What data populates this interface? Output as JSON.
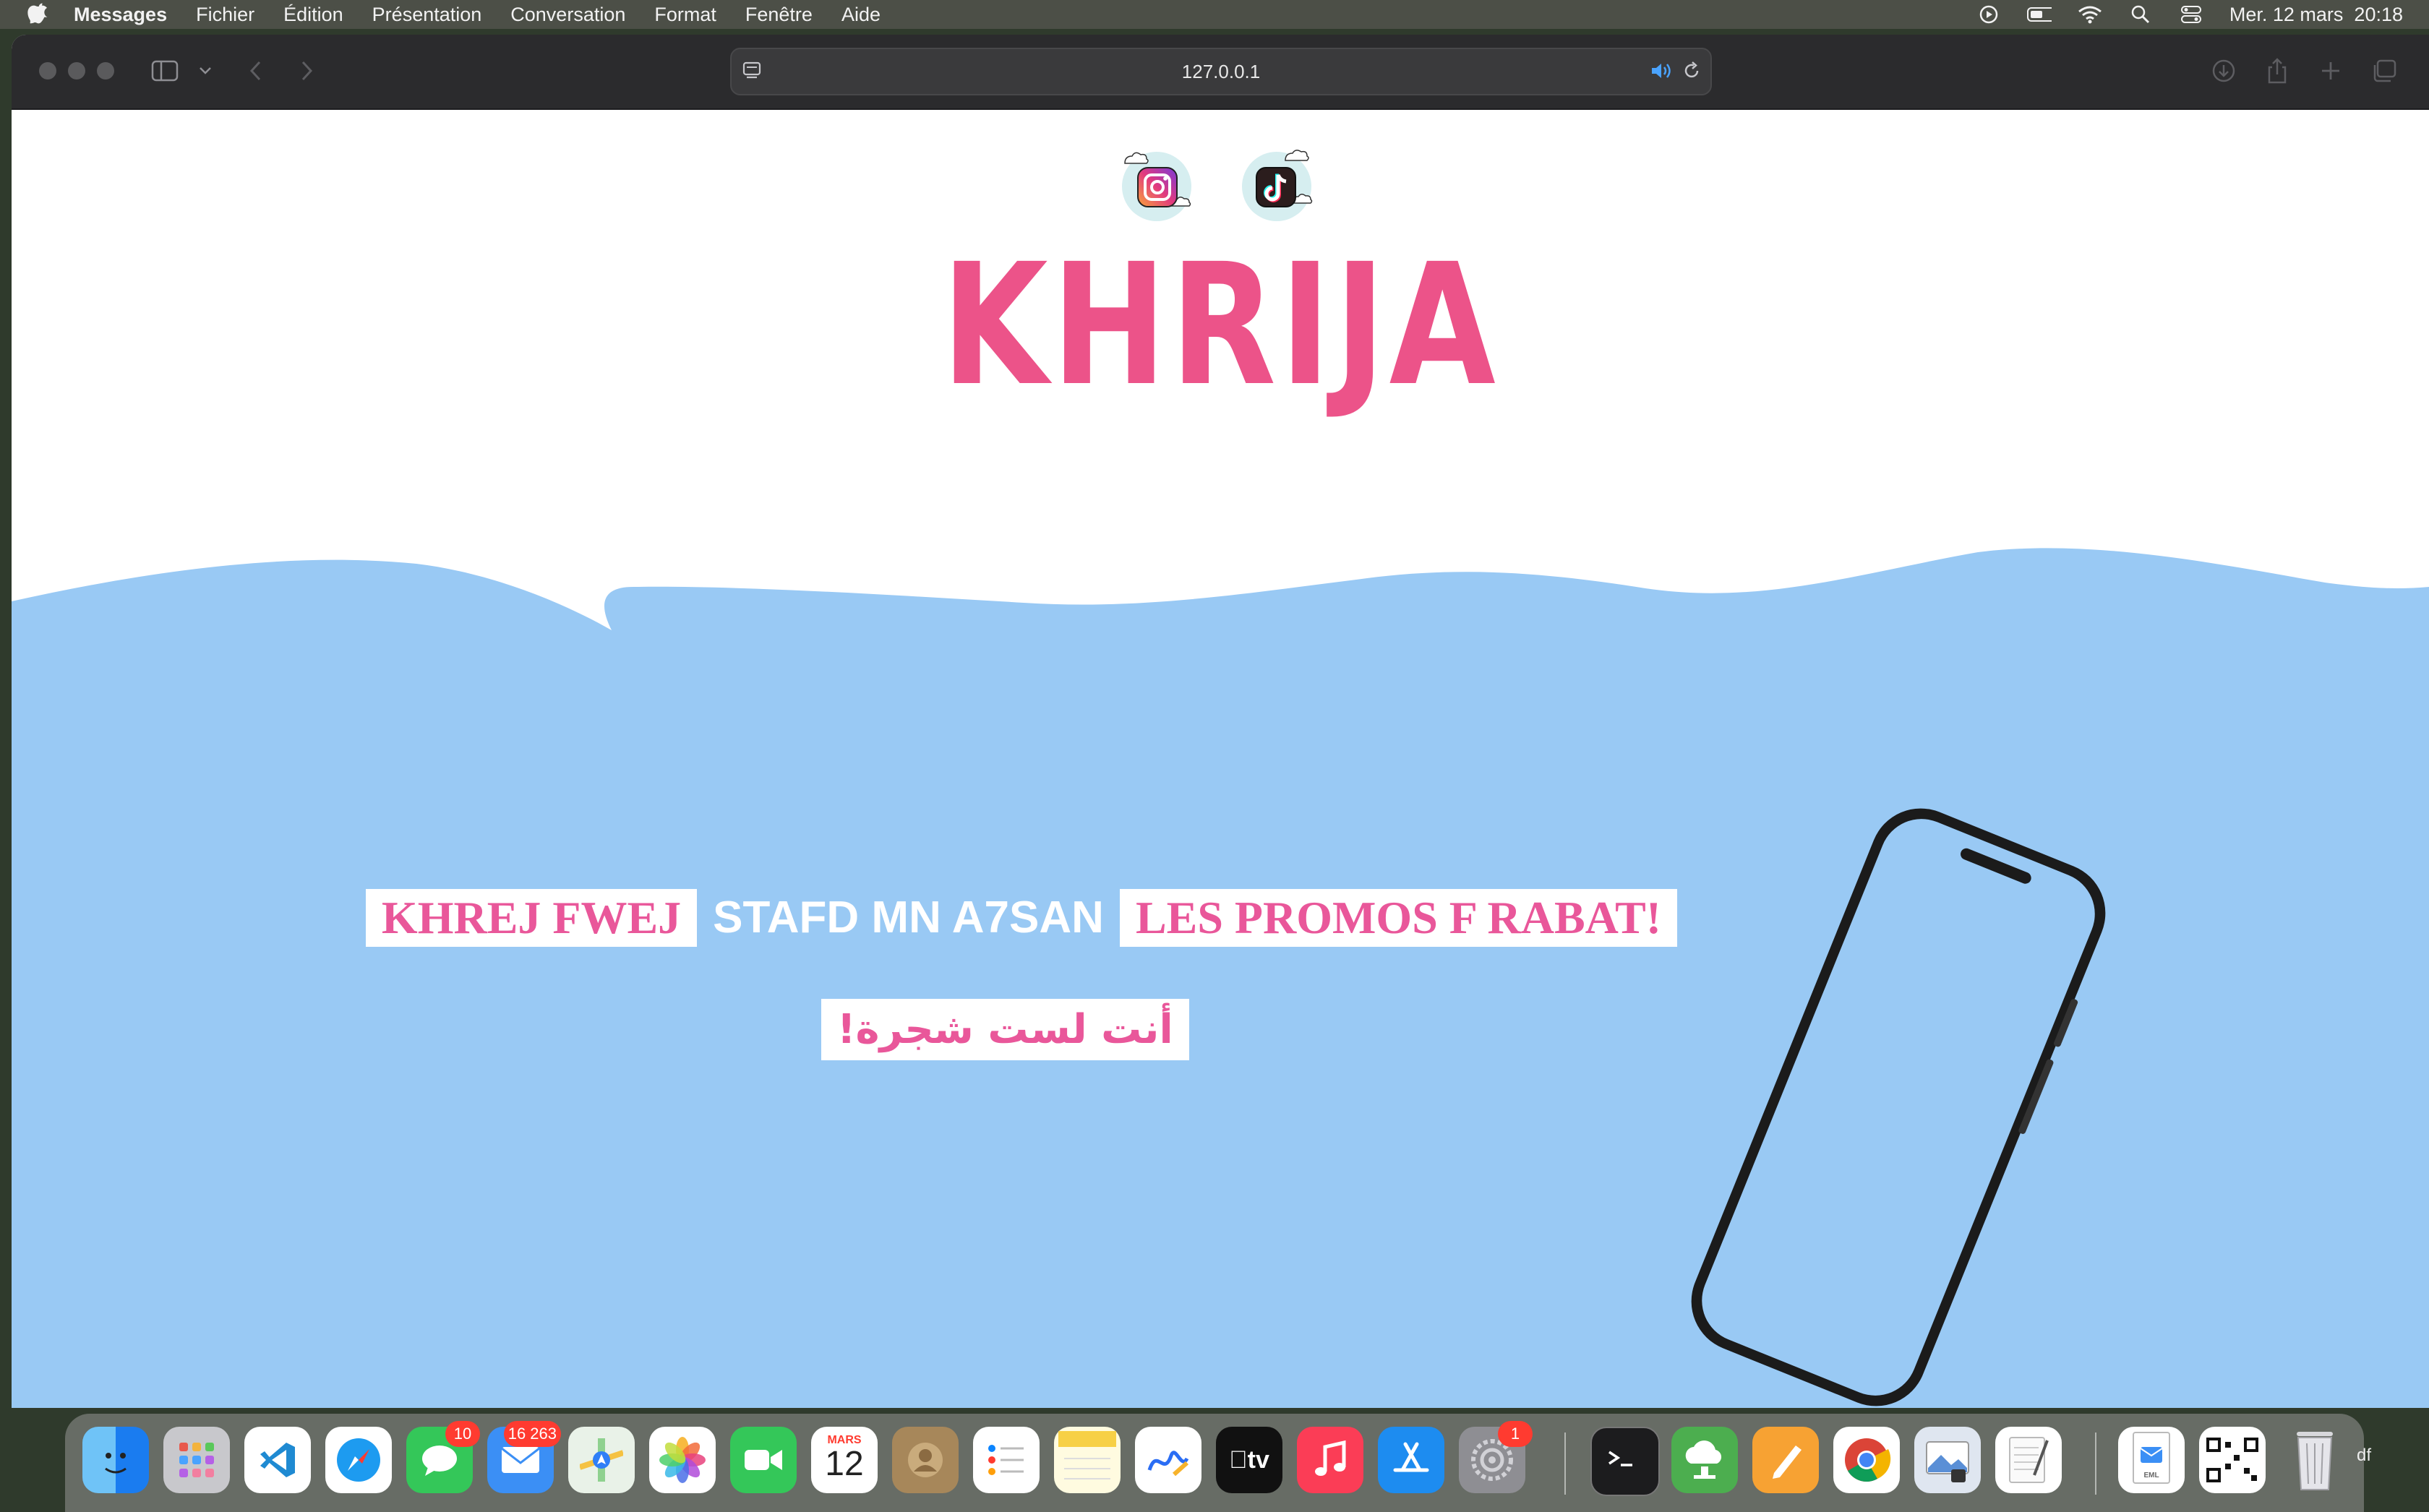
{
  "menubar": {
    "app_name": "Messages",
    "menus": [
      "Fichier",
      "Édition",
      "Présentation",
      "Conversation",
      "Format",
      "Fenêtre",
      "Aide"
    ],
    "clock": "Mer. 12 mars  20:18"
  },
  "browser": {
    "url": "127.0.0.1"
  },
  "page": {
    "title": "KHRIJA",
    "social": [
      "instagram-icon",
      "tiktok-icon"
    ],
    "tagline": {
      "highlight_1": "KHREJ FWEJ",
      "plain": "STAFD MN A7SAN",
      "highlight_2": "LES PROMOS F RABAT!"
    },
    "arabic_line": "أنت لست شجرة!",
    "colors": {
      "accent_pink": "#ec5389",
      "sky_blue": "#99c9f4",
      "white": "#ffffff"
    }
  },
  "dock": {
    "messages_badge": "10",
    "mail_badge": "16 263",
    "calendar_month": "MARS",
    "calendar_day": "12",
    "settings_badge": "1",
    "trailing_text": "df"
  }
}
